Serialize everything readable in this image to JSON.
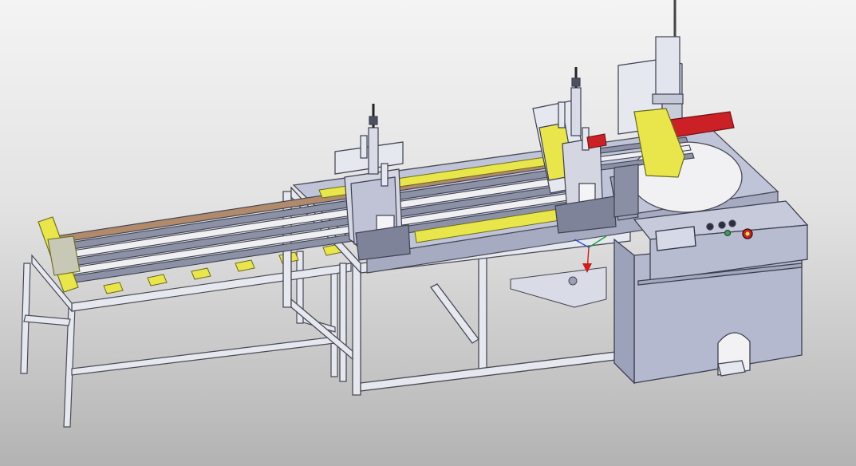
{
  "scene": {
    "colors": {
      "background_top": "#f4f4f4",
      "background_bottom": "#b3b3b3",
      "frame": "#e6e8ef",
      "frame_stroke": "#4a4a55",
      "panel": "#b5b9cf",
      "panel_dark": "#9da2bb",
      "accent_yellow": "#e8e64a",
      "accent_red": "#cc2027",
      "profile_brown": "#b08a6a",
      "rail": "#7a7f93"
    },
    "icons": {
      "emergency_stop": "red-mushroom-button",
      "foot_pedal": "foot-pedal",
      "pneumatic_cylinder": "cylinder",
      "coordinate_triad": "xyz-axes-triad"
    }
  }
}
